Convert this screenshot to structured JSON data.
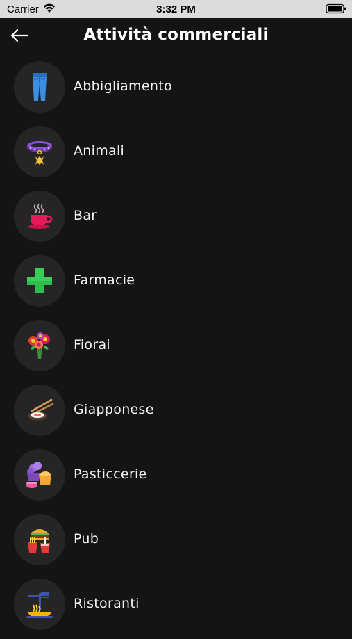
{
  "status_bar": {
    "carrier": "Carrier",
    "time": "3:32 PM"
  },
  "header": {
    "title": "Attività commerciali",
    "back_icon": "arrow-left-icon"
  },
  "categories": [
    {
      "label": "Abbigliamento",
      "icon": "jeans-icon"
    },
    {
      "label": "Animali",
      "icon": "pet-collar-icon"
    },
    {
      "label": "Bar",
      "icon": "coffee-cup-icon"
    },
    {
      "label": "Farmacie",
      "icon": "pharmacy-cross-icon"
    },
    {
      "label": "Fiorai",
      "icon": "flower-bouquet-icon"
    },
    {
      "label": "Giapponese",
      "icon": "sushi-icon"
    },
    {
      "label": "Pasticcerie",
      "icon": "cupcake-icon"
    },
    {
      "label": "Pub",
      "icon": "burger-icon"
    },
    {
      "label": "Ristoranti",
      "icon": "pasta-icon"
    }
  ],
  "colors": {
    "background": "#141414",
    "icon_circle": "#252525",
    "status_bar": "#dcdcdc"
  }
}
